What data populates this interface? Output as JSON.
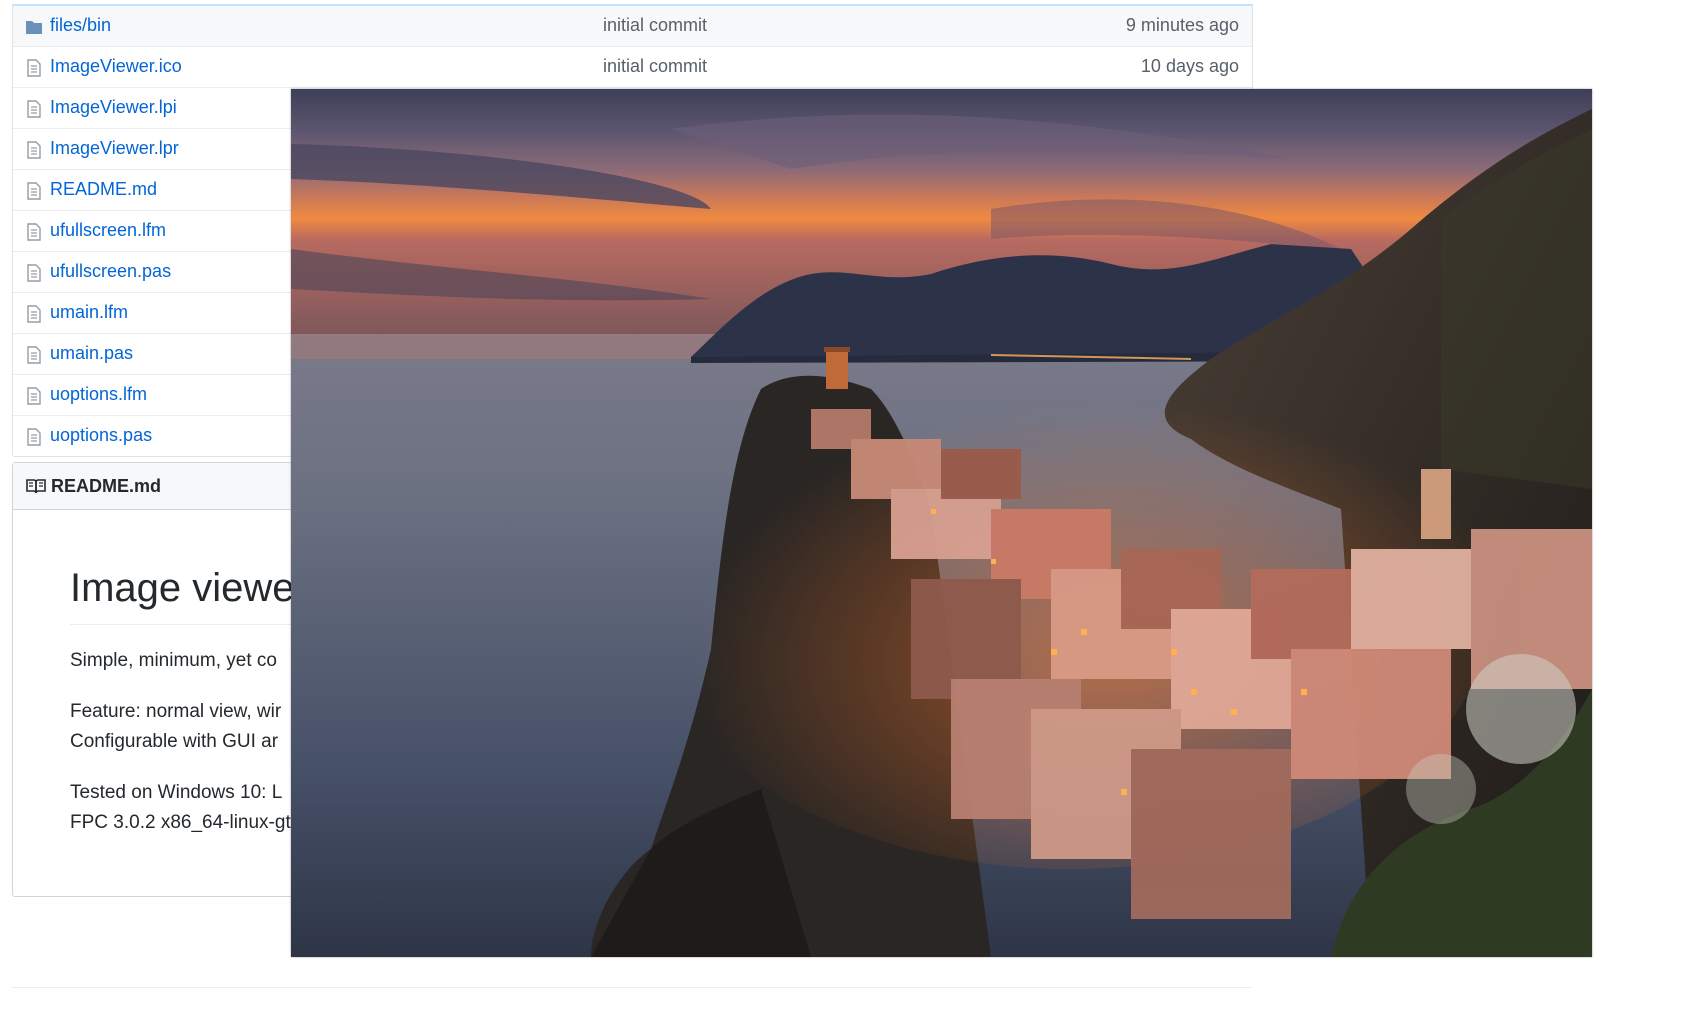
{
  "files": [
    {
      "name": "files/bin",
      "type": "folder",
      "message": "initial commit",
      "age": "9 minutes ago"
    },
    {
      "name": "ImageViewer.ico",
      "type": "file",
      "message": "initial commit",
      "age": "10 days ago"
    },
    {
      "name": "ImageViewer.lpi",
      "type": "file",
      "message": "",
      "age": ""
    },
    {
      "name": "ImageViewer.lpr",
      "type": "file",
      "message": "",
      "age": ""
    },
    {
      "name": "README.md",
      "type": "file",
      "message": "",
      "age": ""
    },
    {
      "name": "ufullscreen.lfm",
      "type": "file",
      "message": "",
      "age": ""
    },
    {
      "name": "ufullscreen.pas",
      "type": "file",
      "message": "",
      "age": ""
    },
    {
      "name": "umain.lfm",
      "type": "file",
      "message": "",
      "age": ""
    },
    {
      "name": "umain.pas",
      "type": "file",
      "message": "",
      "age": ""
    },
    {
      "name": "uoptions.lfm",
      "type": "file",
      "message": "",
      "age": ""
    },
    {
      "name": "uoptions.pas",
      "type": "file",
      "message": "",
      "age": ""
    }
  ],
  "readme": {
    "header": "README.md",
    "heading": "Image viewe",
    "paragraph1": "Simple, minimum, yet co",
    "paragraph2_line1": "Feature: normal view, wir",
    "paragraph2_line2": "Configurable with GUI ar",
    "paragraph3_line1": "Tested on Windows 10: L",
    "paragraph3_line2": "FPC 3.0.2 x86_64-linux-gt"
  },
  "viewer": {
    "icon": "photo-sunset-coastal-village",
    "colors": {
      "sky_top": "#4a4a66",
      "sunset": "#e0703a",
      "sea": "#3f4558",
      "rock": "#2a2522"
    }
  },
  "colors": {
    "link": "#0366d6",
    "muted": "#586069",
    "border": "#dfe2e5",
    "row_highlight": "#f6f8fa"
  }
}
